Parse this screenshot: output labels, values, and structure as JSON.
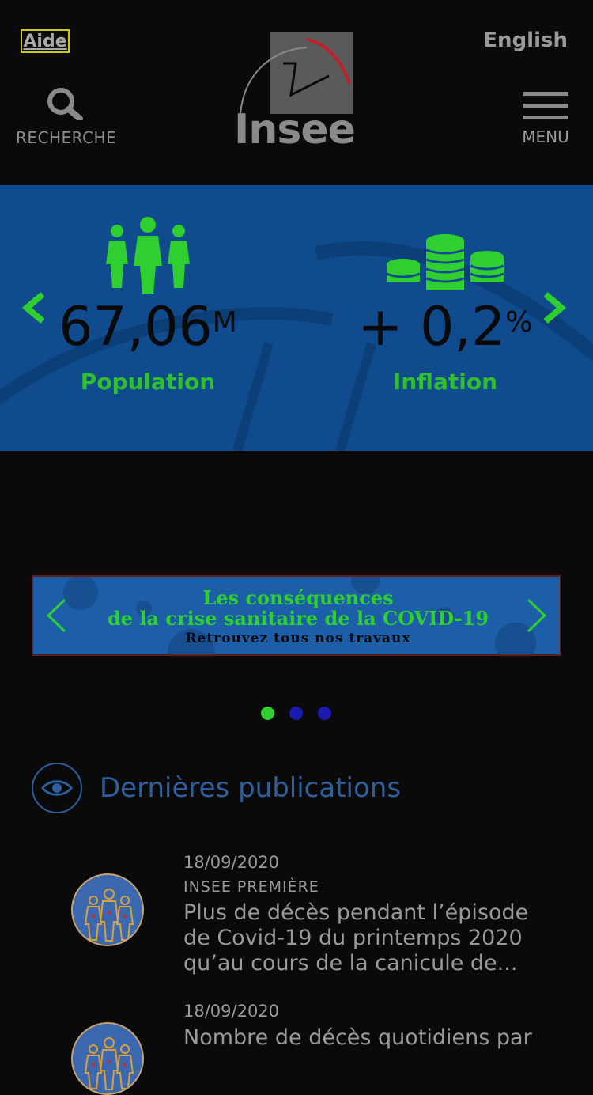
{
  "header": {
    "help_label": "Aide",
    "language_label": "English",
    "search_label": "RECHERCHE",
    "menu_label": "MENU",
    "logo_text": "Insee"
  },
  "key_figures": [
    {
      "value": "67,06",
      "unit": "M",
      "label": "Population",
      "icon": "people-icon"
    },
    {
      "value": "+ 0,2",
      "unit": "%",
      "label": "Inflation",
      "icon": "coins-icon"
    }
  ],
  "covid_banner": {
    "line1": "Les conséquences",
    "line2": "de la crise sanitaire de la COVID-19",
    "line3": "Retrouvez tous nos travaux"
  },
  "carousel": {
    "dots": 3,
    "active_index": 0
  },
  "publications": {
    "heading": "Dernières publications",
    "items": [
      {
        "date": "18/09/2020",
        "category": "INSEE PREMIÈRE",
        "title_lines": [
          "Plus de décès pendant l’épisode",
          "de Covid-19 du printemps 2020",
          "qu’au cours de la canicule de..."
        ]
      },
      {
        "date": "18/09/2020",
        "category": "",
        "title_lines": [
          "Nombre de décès quotidiens par"
        ]
      }
    ]
  },
  "colors": {
    "background": "#0a0a0a",
    "band": "#0f4b8d",
    "accent_green": "#2ecf2e",
    "heading_blue": "#2f5f9a",
    "dot_inactive": "#1a1ab0"
  }
}
